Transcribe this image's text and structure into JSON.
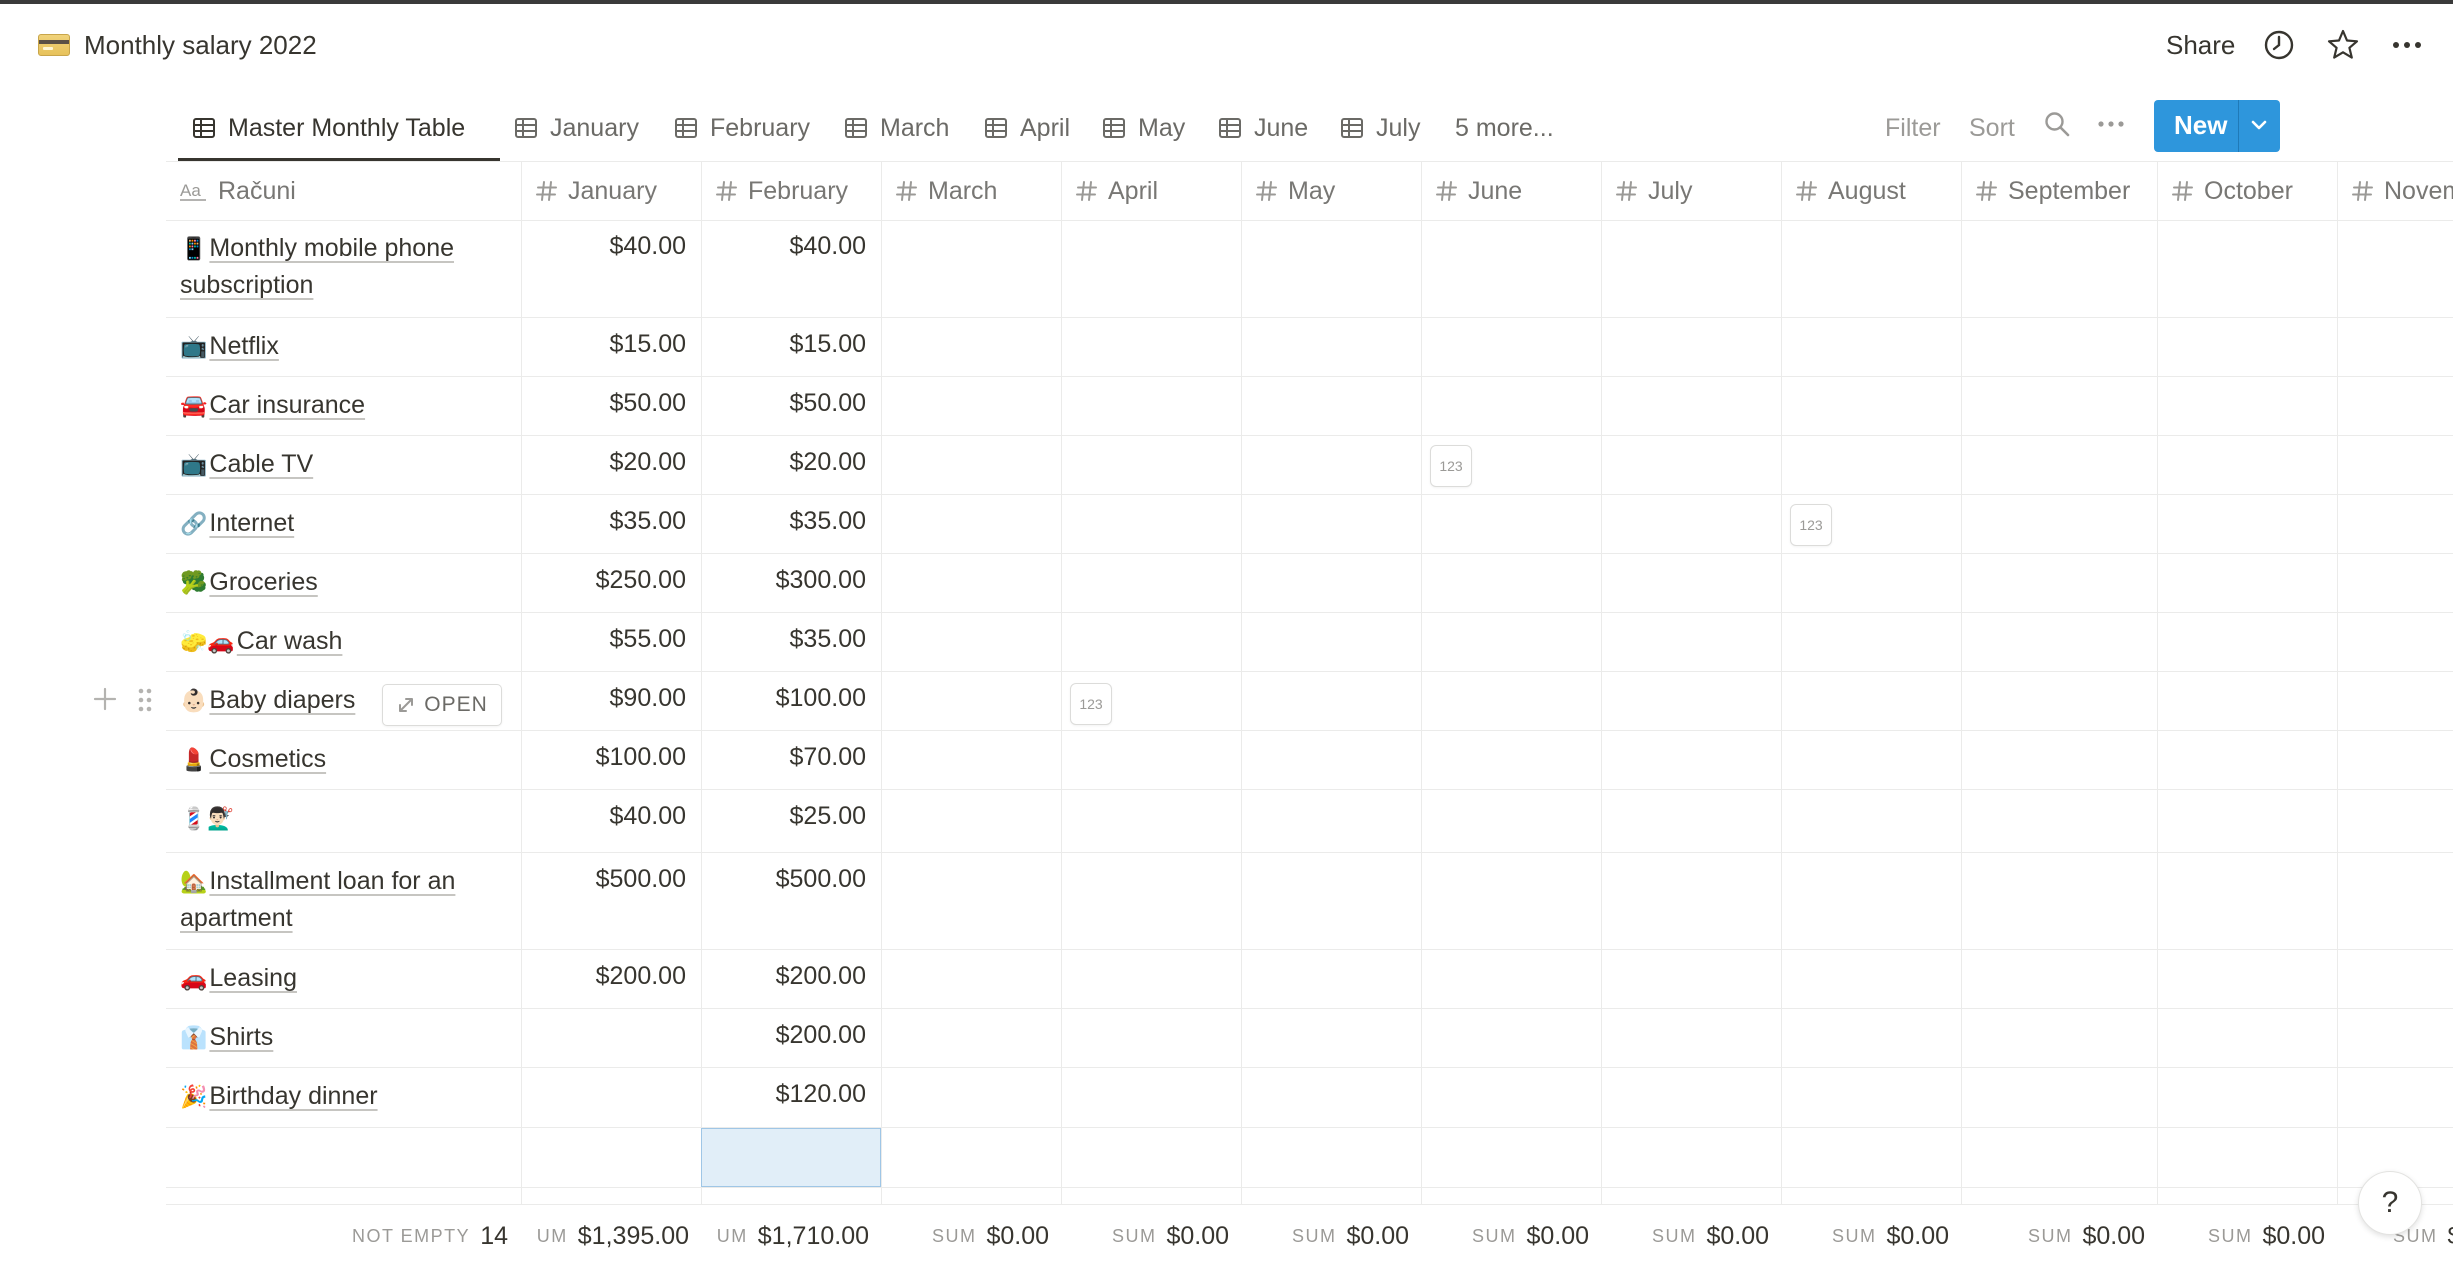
{
  "page": {
    "title": "Monthly salary 2022",
    "icon": "credit-card-icon"
  },
  "topbar": {
    "share_label": "Share",
    "icons": [
      "clock-icon",
      "star-icon",
      "more-icon"
    ]
  },
  "views": {
    "tabs": [
      {
        "label": "Master Monthly Table",
        "active": true
      },
      {
        "label": "January"
      },
      {
        "label": "February"
      },
      {
        "label": "March"
      },
      {
        "label": "April"
      },
      {
        "label": "May"
      },
      {
        "label": "June"
      },
      {
        "label": "July"
      }
    ],
    "more_label": "5 more...",
    "filter_label": "Filter",
    "sort_label": "Sort",
    "new_label": "New"
  },
  "table": {
    "title_column": "Računi",
    "columns": [
      "January",
      "February",
      "March",
      "April",
      "May",
      "June",
      "July",
      "August",
      "September",
      "October",
      "November"
    ],
    "rows": [
      {
        "emoji": "📱",
        "name": "Monthly mobile phone subscription",
        "january": "$40.00",
        "february": "$40.00"
      },
      {
        "emoji": "📺",
        "name": "Netflix",
        "january": "$15.00",
        "february": "$15.00"
      },
      {
        "emoji": "🚘",
        "name": "Car insurance",
        "january": "$50.00",
        "february": "$50.00"
      },
      {
        "emoji": "📺",
        "name": "Cable TV",
        "january": "$20.00",
        "february": "$20.00"
      },
      {
        "emoji": "🔗",
        "name": "Internet",
        "january": "$35.00",
        "february": "$35.00"
      },
      {
        "emoji": "🥦",
        "name": "Groceries",
        "january": "$250.00",
        "february": "$300.00"
      },
      {
        "emoji": "🧽🚗",
        "name": "Car wash",
        "january": "$55.00",
        "february": "$35.00"
      },
      {
        "emoji": "👶🏻",
        "name": "Baby diapers",
        "january": "$90.00",
        "february": "$100.00"
      },
      {
        "emoji": "💄",
        "name": "Cosmetics",
        "january": "$100.00",
        "february": "$70.00"
      },
      {
        "emoji": "💈💇🏻‍♂️",
        "name": "",
        "january": "$40.00",
        "february": "$25.00"
      },
      {
        "emoji": "🏡",
        "name": "Installment loan for an apartment",
        "january": "$500.00",
        "february": "$500.00"
      },
      {
        "emoji": "🚗",
        "name": "Leasing",
        "january": "$200.00",
        "february": "$200.00"
      },
      {
        "emoji": "👔",
        "name": "Shirts",
        "january": "",
        "february": "$200.00"
      },
      {
        "emoji": "🎉",
        "name": "Birthday dinner",
        "january": "",
        "february": "$120.00"
      }
    ],
    "open_label": "OPEN",
    "badge_label": "123"
  },
  "footer": {
    "title": {
      "label": "NOT EMPTY",
      "value": "14"
    },
    "january": {
      "label": "UM",
      "value": "$1,395.00"
    },
    "february": {
      "label": "UM",
      "value": "$1,710.00"
    },
    "march": {
      "label": "SUM",
      "value": "$0.00"
    },
    "april": {
      "label": "SUM",
      "value": "$0.00"
    },
    "may": {
      "label": "SUM",
      "value": "$0.00"
    },
    "june": {
      "label": "SUM",
      "value": "$0.00"
    },
    "july": {
      "label": "SUM",
      "value": "$0.00"
    },
    "august": {
      "label": "SUM",
      "value": "$0.00"
    },
    "september": {
      "label": "SUM",
      "value": "$0.00"
    },
    "october": {
      "label": "SUM",
      "value": "$0.00"
    },
    "november": {
      "label": "SUM",
      "value": "$"
    }
  },
  "help_label": "?"
}
